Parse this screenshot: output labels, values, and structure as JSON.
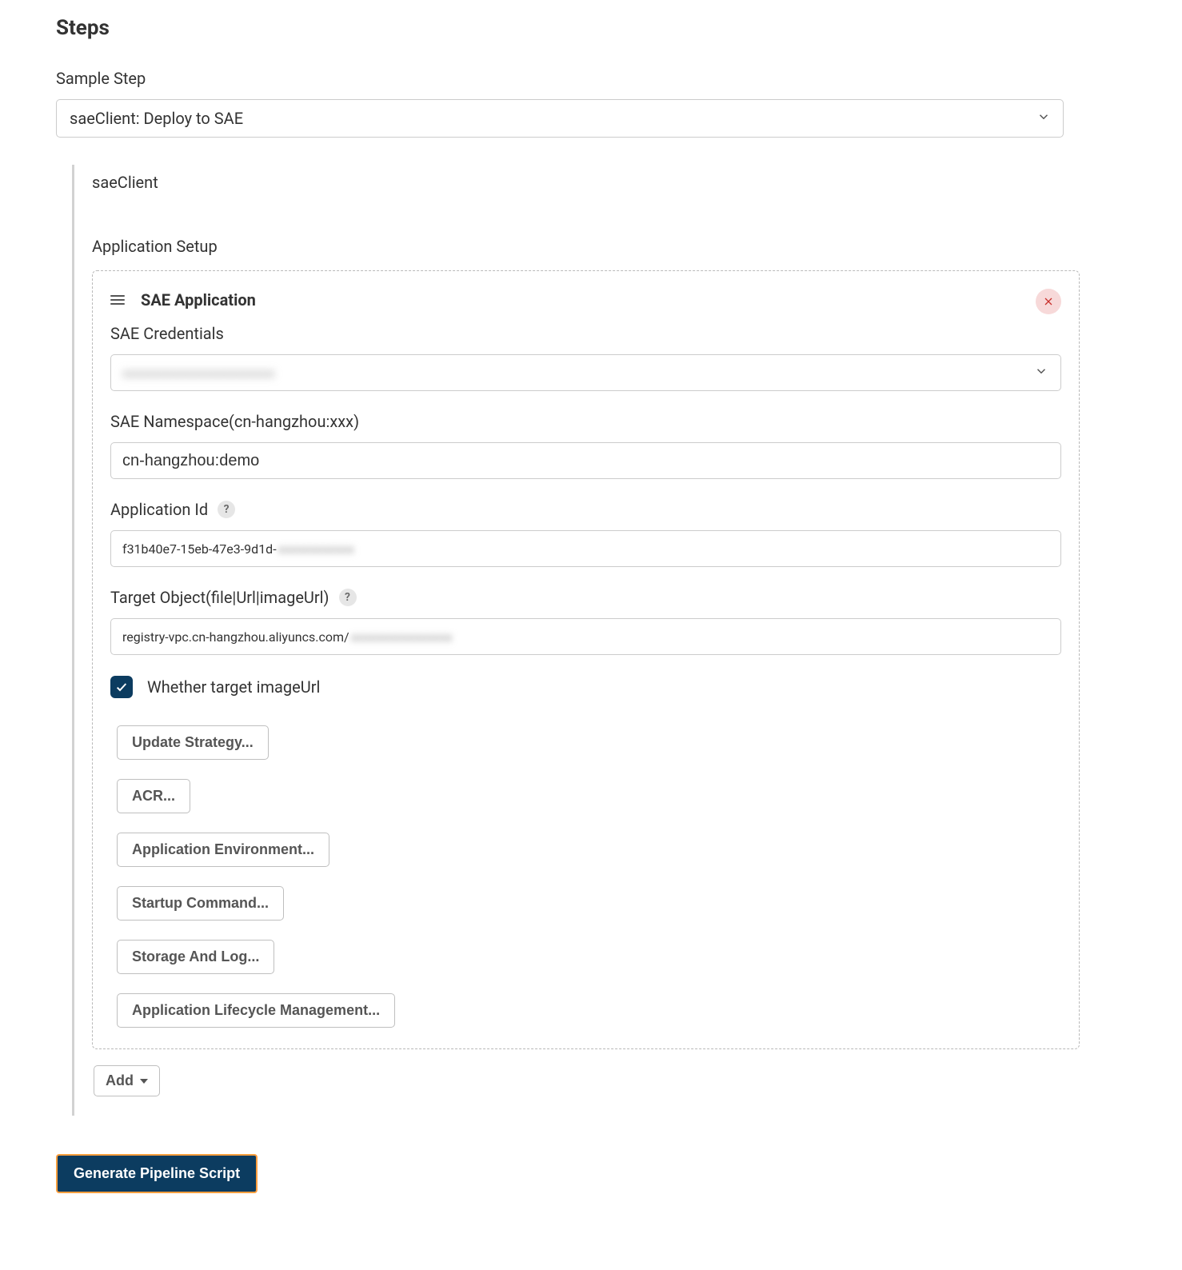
{
  "page": {
    "title": "Steps",
    "sample_step_label": "Sample Step",
    "sample_step_value": "saeClient: Deploy to SAE"
  },
  "section": {
    "saeclient_label": "saeClient",
    "app_setup_label": "Application Setup"
  },
  "panel": {
    "title": "SAE Application",
    "fields": {
      "credentials": {
        "label": "SAE Credentials",
        "value_visible": "",
        "value_redacted": "xxxxxxxxxxxxxxxxxxxxxxxx"
      },
      "namespace": {
        "label": "SAE Namespace(cn-hangzhou:xxx)",
        "value": "cn-hangzhou:demo"
      },
      "app_id": {
        "label": "Application Id",
        "value_visible": "f31b40e7-15eb-47e3-9d1d-",
        "value_redacted": "xxxxxxxxxxxx"
      },
      "target_object": {
        "label": "Target Object(file|Url|imageUrl)",
        "value_visible": "registry-vpc.cn-hangzhou.aliyuncs.com/",
        "value_redacted": "xxxxxxxxxxxxxxxx"
      },
      "whether_target_imageurl": {
        "label": "Whether target imageUrl",
        "checked": true
      }
    },
    "expand_buttons": [
      "Update Strategy...",
      "ACR...",
      "Application Environment...",
      "Startup Command...",
      "Storage And Log...",
      "Application Lifecycle Management..."
    ],
    "add_button": "Add"
  },
  "footer": {
    "generate_button": "Generate Pipeline Script"
  },
  "help_tooltip": "?"
}
